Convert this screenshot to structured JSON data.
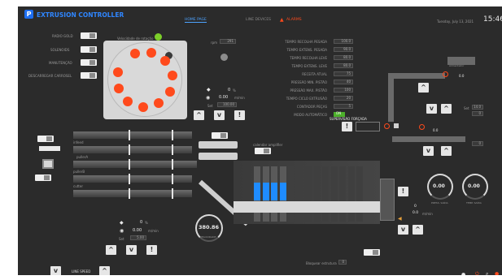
{
  "header": {
    "app_title": "EXTRUSION CONTROLLER",
    "date": "Tuesday, July 13, 2021",
    "time": "15:46",
    "brand_color": "#1e6ef0",
    "accent_color": "#ff4a1c"
  },
  "tabs": [
    {
      "label": "HOME PAGE",
      "active": true
    },
    {
      "label": "LINE DEVICES",
      "active": false
    },
    {
      "label": "ALARMS",
      "active": false
    }
  ],
  "side_toggles": [
    {
      "label": "RADIO GOLD"
    },
    {
      "label": "SOLENOIDS"
    },
    {
      "label": "MANUTENÇÃO"
    },
    {
      "label": "DESCARREGAR CARROSEL"
    }
  ],
  "carousel": {
    "label": "Velocidade de rotação",
    "rpm_value": "291",
    "roller_count": 10
  },
  "center_readout": {
    "percent": "0",
    "percent_unit": "%",
    "speed": "0.00",
    "speed_unit": "m/min",
    "setpoint_prefix": "Set",
    "setpoint": "100.00"
  },
  "parameters": [
    {
      "label": "TEMPO RECOLHA PESADA",
      "value": "100.0"
    },
    {
      "label": "TEMPO EXTENS. PESADA",
      "value": "90.0"
    },
    {
      "label": "TEMPO RECOLHA LEVE",
      "value": "80.0"
    },
    {
      "label": "TEMPO EXTENS. LEVE",
      "value": "80.0"
    },
    {
      "label": "RECEITA ATUAL",
      "value": "75"
    },
    {
      "label": "PRESSÃO MIN. PISTÃO",
      "value": "40"
    },
    {
      "label": "PRESSÃO MAX. PISTÃO",
      "value": "100"
    },
    {
      "label": "TEMPO CICLO EXTRUSÃO",
      "value": "20"
    },
    {
      "label": "CONTADOR PEÇAS",
      "value": "5"
    },
    {
      "label": "MODO AUTOMÁTICO",
      "value": "ON"
    }
  ],
  "conveyor": {
    "labels": [
      "infeed",
      "pullerA",
      "pullerB",
      "cutter"
    ]
  },
  "left_readout": {
    "percent": "0",
    "percent_unit": "%",
    "speed": "0.00",
    "speed_unit": "m/min",
    "setpoint_prefix": "Set",
    "setpoint": "5.00"
  },
  "main_gauge": {
    "value": "380.86",
    "label": "VELOCIDADE"
  },
  "mid_label": "calendar amplifier",
  "right_panel": {
    "title": "SUPERVISÃO FORÇADA",
    "hopper_label": "Alimentador",
    "hopper_value": "0.0",
    "set_a_value": "14.0",
    "set_b_value": "0",
    "set_c_value": "0",
    "small_readout": "0.0"
  },
  "right_gauges": [
    {
      "value": "0.00",
      "label": "PRESS. SAÍDA"
    },
    {
      "value": "0.00",
      "label": "TEMP. SAÍDA"
    }
  ],
  "lower_right": {
    "percent": "0",
    "speed": "0.0",
    "unit": "m/min"
  },
  "footer": {
    "line_speed_label": "LINE SPEED",
    "bottom_label": "Bloquear estrutura",
    "bottom_value": "0"
  }
}
